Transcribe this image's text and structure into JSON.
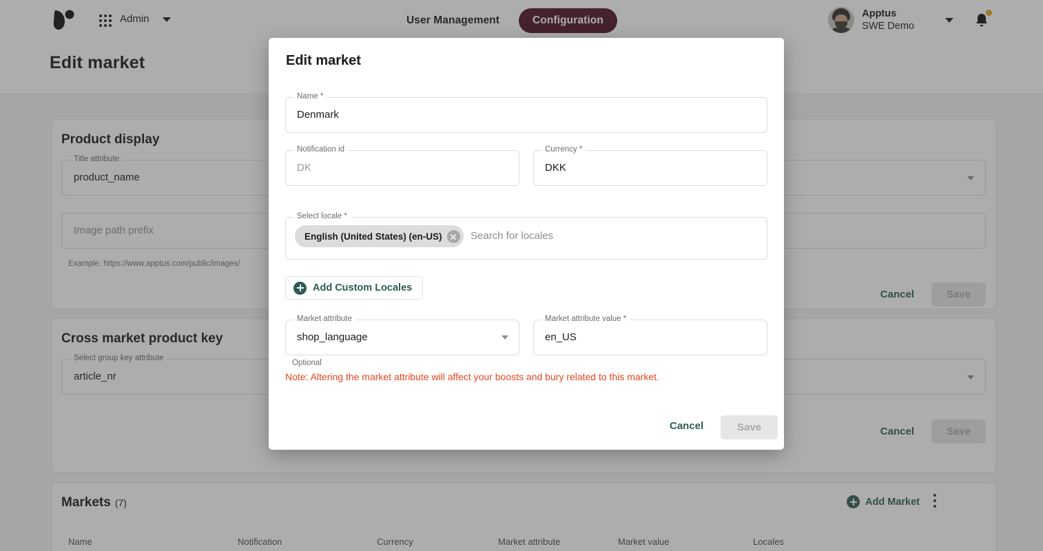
{
  "topbar": {
    "logo_icon": "apptus-logo-icon",
    "apps_icon": "apps-grid-icon",
    "admin_label": "Admin",
    "admin_caret_icon": "chevron-down-icon",
    "nav": [
      {
        "label": "User Management",
        "active": false
      },
      {
        "label": "Configuration",
        "active": true
      }
    ],
    "user": {
      "org": "Apptus",
      "account": "SWE Demo",
      "avatar_icon": "user-avatar",
      "caret_icon": "chevron-down-icon"
    },
    "bell_icon": "notification-bell-icon",
    "bell_has_badge": true,
    "accent_active": "#4d1026",
    "badge_color": "#e6a817"
  },
  "page": {
    "title": "Edit market",
    "product_display": {
      "title": "Product display",
      "title_attribute": {
        "label": "Title attribute",
        "value": "product_name"
      },
      "image_path": {
        "placeholder": "Image path prefix",
        "helper": "Example: https://www.apptus.com/public/images/"
      },
      "cancel_label": "Cancel",
      "save_label": "Save"
    },
    "cross_market": {
      "title": "Cross market product key",
      "group_key": {
        "label": "Select group key attribute",
        "value": "article_nr"
      },
      "cancel_label": "Cancel",
      "save_label": "Save"
    },
    "markets": {
      "title": "Markets",
      "count": "(7)",
      "add_label": "Add Market",
      "add_icon": "plus-circle-icon",
      "kebab_icon": "more-vertical-icon",
      "columns": [
        "Name",
        "Notification",
        "Currency",
        "Market attribute",
        "Market value",
        "Locales"
      ]
    }
  },
  "modal": {
    "title": "Edit market",
    "name": {
      "label": "Name *",
      "value": "Denmark"
    },
    "notification_id": {
      "label": "Notification id",
      "placeholder": "DK"
    },
    "currency": {
      "label": "Currency *",
      "value": "DKK"
    },
    "select_locale": {
      "label": "Select locale *",
      "chips": [
        {
          "label": "English (United States) (en-US)",
          "remove_icon": "close-circle-icon"
        }
      ],
      "placeholder": "Search for locales"
    },
    "add_custom_locales": {
      "label": "Add Custom Locales",
      "icon": "plus-circle-icon"
    },
    "market_attribute": {
      "label": "Market attribute",
      "value": "shop_language",
      "caret_icon": "chevron-down-icon"
    },
    "market_attribute_value": {
      "label": "Market attribute value *",
      "value": "en_US"
    },
    "optional_helper": "Optional",
    "note": "Note: Altering the market attribute will affect your boosts and bury related to this market.",
    "note_color": "#e8441f",
    "cancel_label": "Cancel",
    "save_label": "Save"
  }
}
